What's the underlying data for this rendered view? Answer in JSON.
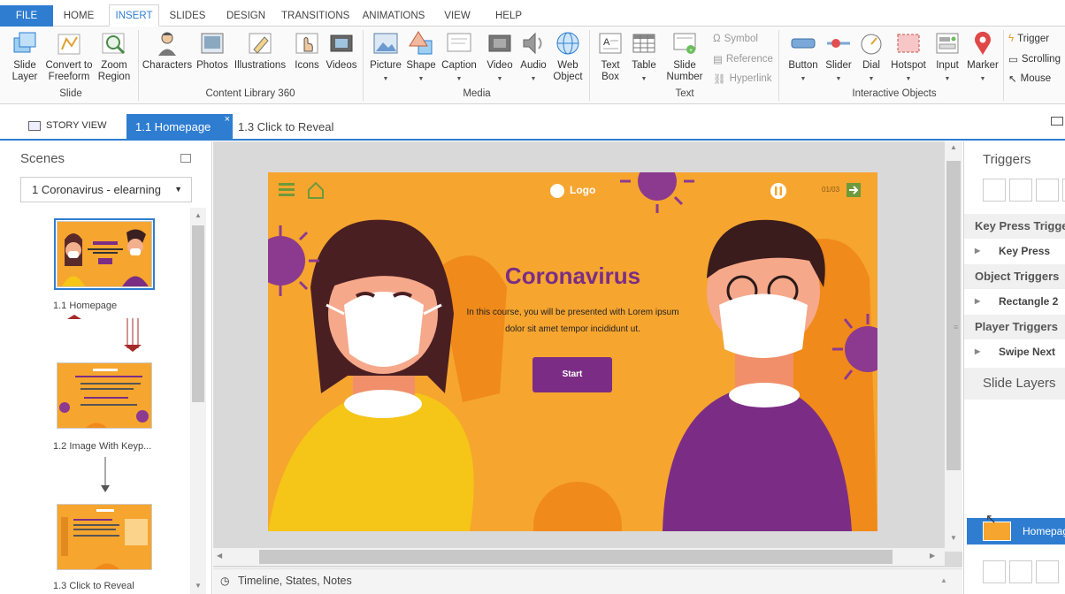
{
  "ribbon_tabs": [
    "FILE",
    "HOME",
    "INSERT",
    "SLIDES",
    "DESIGN",
    "TRANSITIONS",
    "ANIMATIONS",
    "VIEW",
    "HELP"
  ],
  "ribbon": {
    "slide_layer": "Slide\nLayer",
    "convert_freeform_1": "Convert to",
    "convert_freeform_2": "Freeform",
    "zoom_region_1": "Zoom",
    "zoom_region_2": "Region",
    "group_slide": "Slide",
    "characters": "Characters",
    "photos": "Photos",
    "illustrations": "Illustrations",
    "icons": "Icons",
    "videos": "Videos",
    "group_content_library": "Content Library 360",
    "picture": "Picture",
    "shape": "Shape",
    "caption": "Caption",
    "video": "Video",
    "audio": "Audio",
    "web_object_1": "Web",
    "web_object_2": "Object",
    "group_media": "Media",
    "text_box_1": "Text",
    "text_box_2": "Box",
    "table": "Table",
    "slide_number_1": "Slide",
    "slide_number_2": "Number",
    "symbol": "Symbol",
    "reference": "Reference",
    "hyperlink": "Hyperlink",
    "group_text": "Text",
    "button": "Button",
    "slider": "Slider",
    "dial": "Dial",
    "hotspot": "Hotspot",
    "input": "Input",
    "marker": "Marker",
    "group_interactive": "Interactive Objects",
    "trigger": "Trigger",
    "scrolling": "Scrolling",
    "mouse": "Mouse"
  },
  "doc_tabs": {
    "story_view": "STORY VIEW",
    "active": "1.1 Homepage",
    "other": "1.3 Click to Reveal"
  },
  "scenes": {
    "title": "Scenes",
    "dropdown": "1 Coronavirus - elearning",
    "slides": [
      "1.1 Homepage",
      "1.2 Image With Keyp...",
      "1.3 Click to Reveal"
    ]
  },
  "slide": {
    "logo": "Logo",
    "counter": "01/03",
    "title": "Coronavirus",
    "body_1": "In this course, you will be presented with Lorem ipsum",
    "body_2": "dolor sit amet  tempor incididunt ut.",
    "start": "Start",
    "thumb_title": "Coronavirus"
  },
  "bottom": {
    "timeline": "Timeline, States, Notes"
  },
  "triggers": {
    "title": "Triggers",
    "sections": [
      {
        "header": "Key Press Triggers",
        "item": "Key Press"
      },
      {
        "header": "Object Triggers",
        "item": "Rectangle 2"
      },
      {
        "header": "Player Triggers",
        "item": "Swipe Next"
      }
    ],
    "slide_layers": "Slide Layers",
    "layer_name": "Homepage"
  },
  "colors": {
    "accent": "#2e7dd1",
    "slide_bg": "#f6a52f",
    "purple": "#7b2d85",
    "virus": "#8c3a8f"
  }
}
